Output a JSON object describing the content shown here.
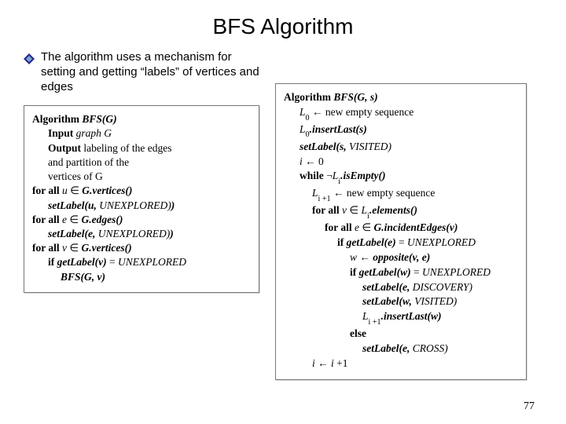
{
  "title": "BFS Algorithm",
  "bullet": "The algorithm uses a mechanism for setting and getting “labels” of vertices and edges",
  "algoLeft": {
    "header_algword": "Algorithm",
    "header_name": "BFS",
    "header_args": "(G)",
    "input_word": "Input",
    "input_rest": " graph G",
    "output_word": "Output",
    "output_rest1": " labeling of the edges",
    "output_rest2": "and partition of the",
    "output_rest3": "vertices of G",
    "l1_for": "for all ",
    "l1_var": " u ",
    "l1_in": "∈",
    "l1_rest": " G.vertices()",
    "l2": "setLabel(u,",
    "l2_rest": " UNEXPLORED)",
    "l3_for": "for all ",
    "l3_var": " e ",
    "l3_in": "∈",
    "l3_rest": " G.edges()",
    "l4": "setLabel(e,",
    "l4_rest": " UNEXPLORED)",
    "l5_for": "for all ",
    "l5_var": " v ",
    "l5_in": "∈",
    "l5_rest": " G.vertices()",
    "l6_if": "if ",
    "l6_get": "getLabel(v)",
    "l6_eq": " = ",
    "l6_rest": "UNEXPLORED",
    "l7": "BFS(G, v)"
  },
  "algoRight": {
    "header_algword": "Algorithm",
    "header_name": "BFS",
    "header_args": "(G, s)",
    "r1_a": "L",
    "r1_sub": "0",
    "r1_b": " ← new empty sequence",
    "r2_a": "L",
    "r2_sub": "0",
    "r2_b": ".insertLast(s)",
    "r3_a": "setLabel(s,",
    "r3_b": " VISITED)",
    "r4_a": "i",
    "r4_b": " ← 0",
    "r5_a": "while ",
    "r5_neg": "¬",
    "r5_b": "L",
    "r5_sub": "i",
    "r5_c": ".isEmpty()",
    "r6_a": "L",
    "r6_sub": "i +1",
    "r6_b": " ← new empty sequence",
    "r7_for": "for all ",
    "r7_var": " v ",
    "r7_in": "∈",
    "r7_b": " L",
    "r7_sub": "i",
    "r7_c": ".elements()",
    "r8_for": "for all ",
    "r8_var": " e ",
    "r8_in": "∈",
    "r8_b": " G.incidentEdges(v)",
    "r9_if": "if ",
    "r9_get": "getLabel(e)",
    "r9_eq": " = ",
    "r9_rest": "UNEXPLORED",
    "r10_a": "w",
    "r10_b": " ← ",
    "r10_c": "opposite(v, e)",
    "r11_if": "if ",
    "r11_get": "getLabel(w)",
    "r11_eq": " = ",
    "r11_rest": "UNEXPLORED",
    "r12_a": "setLabel(e,",
    "r12_b": " DISCOVERY)",
    "r13_a": "setLabel(w,",
    "r13_b": " VISITED)",
    "r14_a": "L",
    "r14_sub": "i +1",
    "r14_b": ".insertLast(w)",
    "r15": "else",
    "r16_a": "setLabel(e,",
    "r16_b": " CROSS)",
    "r17_a": "i",
    "r17_b": " ← ",
    "r17_c": "i",
    "r17_d": " +1"
  },
  "slide_number": "77"
}
